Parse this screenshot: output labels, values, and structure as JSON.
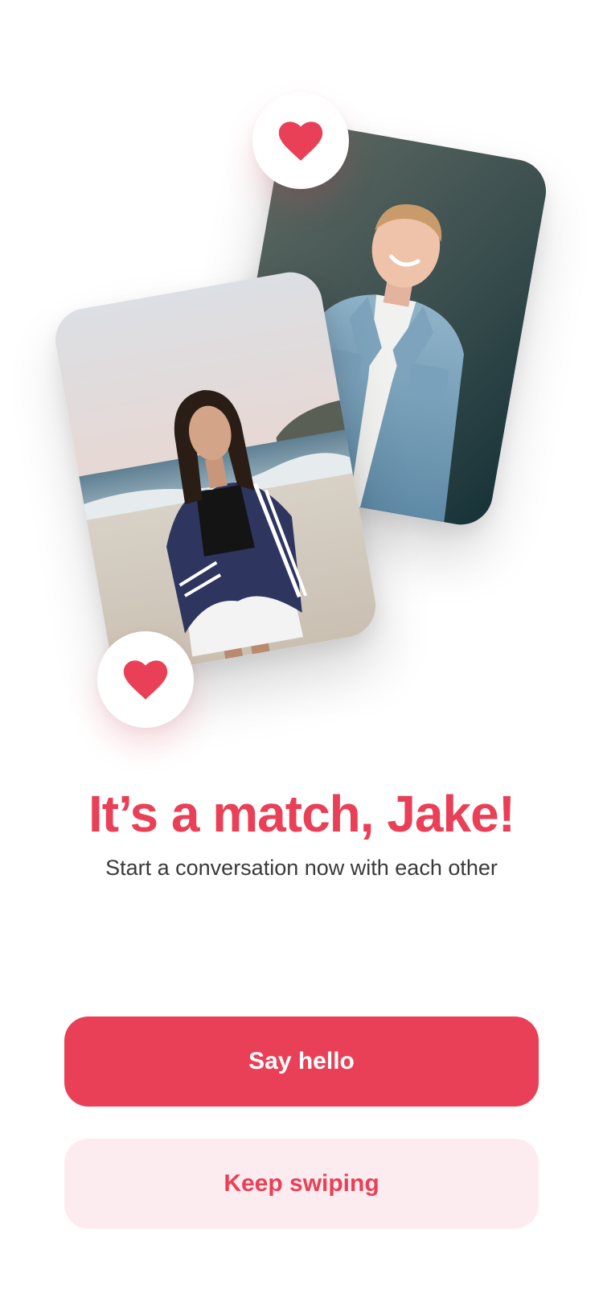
{
  "match": {
    "title": "It’s a match, Jake!",
    "subtitle": "Start a conversation now with each other"
  },
  "actions": {
    "primary_label": "Say hello",
    "secondary_label": "Keep swiping"
  },
  "icons": {
    "heart": "heart-icon"
  },
  "colors": {
    "accent": "#e94057",
    "accent_light": "#fdecef",
    "text_secondary": "#3a3a3a"
  }
}
